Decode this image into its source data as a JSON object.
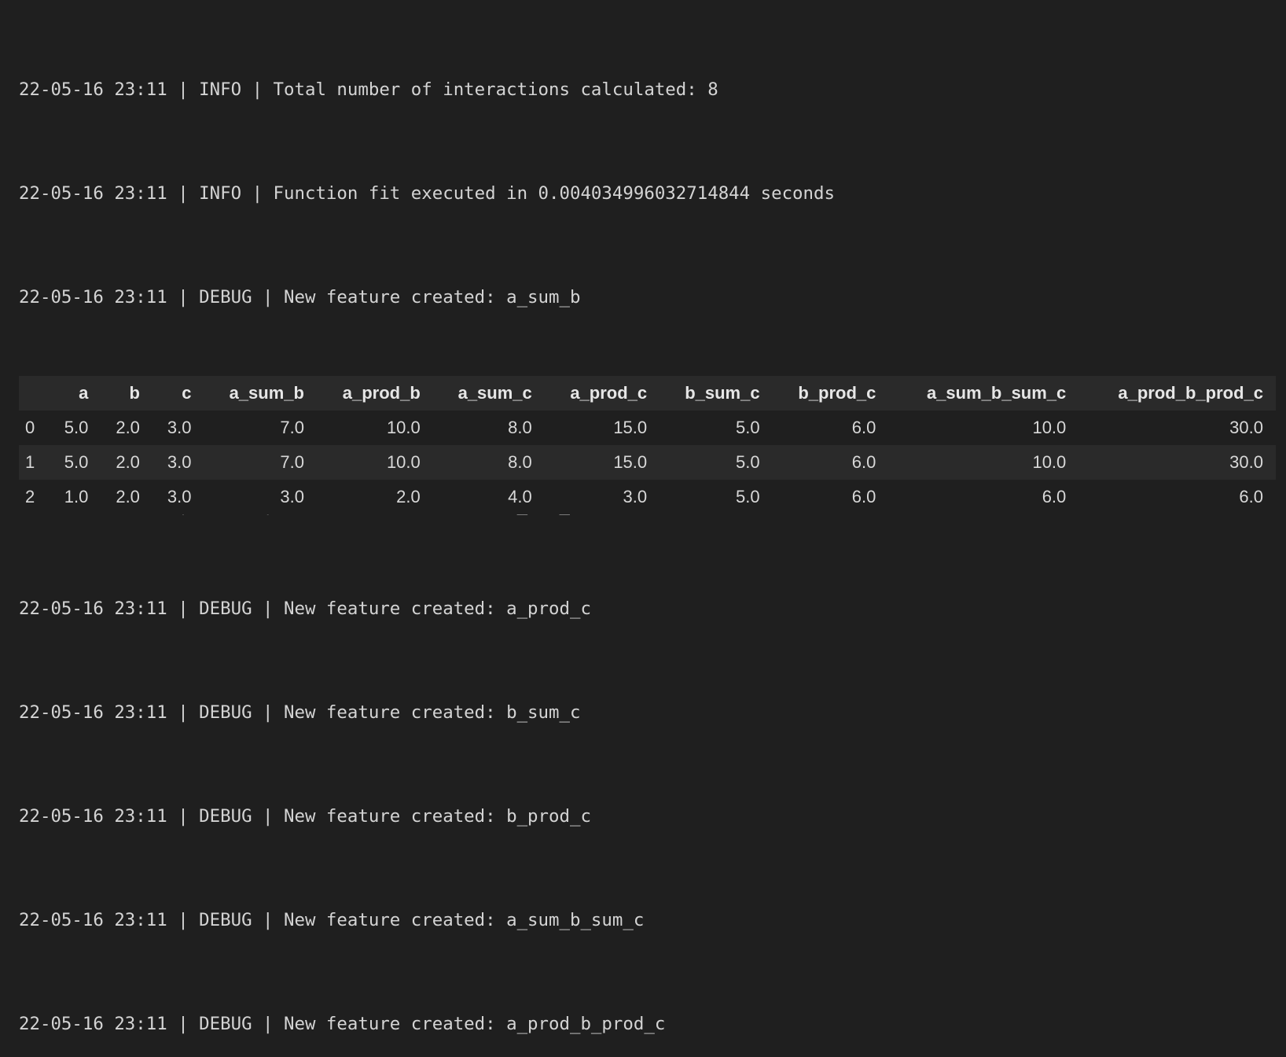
{
  "log_lines": [
    "22-05-16 23:11 | INFO | Total number of interactions calculated: 8",
    "22-05-16 23:11 | INFO | Function fit executed in 0.004034996032714844 seconds",
    "22-05-16 23:11 | DEBUG | New feature created: a_sum_b",
    "22-05-16 23:11 | DEBUG | New feature created: a_prod_b",
    "22-05-16 23:11 | DEBUG | New feature created: a_sum_c",
    "22-05-16 23:11 | DEBUG | New feature created: a_prod_c",
    "22-05-16 23:11 | DEBUG | New feature created: b_sum_c",
    "22-05-16 23:11 | DEBUG | New feature created: b_prod_c",
    "22-05-16 23:11 | DEBUG | New feature created: a_sum_b_sum_c",
    "22-05-16 23:11 | DEBUG | New feature created: a_prod_b_prod_c"
  ],
  "table": {
    "index_header": "",
    "columns": [
      "a",
      "b",
      "c",
      "a_sum_b",
      "a_prod_b",
      "a_sum_c",
      "a_prod_c",
      "b_sum_c",
      "b_prod_c",
      "a_sum_b_sum_c",
      "a_prod_b_prod_c"
    ],
    "rows": [
      {
        "index": "0",
        "values": [
          "5.0",
          "2.0",
          "3.0",
          "7.0",
          "10.0",
          "8.0",
          "15.0",
          "5.0",
          "6.0",
          "10.0",
          "30.0"
        ]
      },
      {
        "index": "1",
        "values": [
          "5.0",
          "2.0",
          "3.0",
          "7.0",
          "10.0",
          "8.0",
          "15.0",
          "5.0",
          "6.0",
          "10.0",
          "30.0"
        ]
      },
      {
        "index": "2",
        "values": [
          "1.0",
          "2.0",
          "3.0",
          "3.0",
          "2.0",
          "4.0",
          "3.0",
          "5.0",
          "6.0",
          "6.0",
          "6.0"
        ]
      }
    ]
  },
  "colors": {
    "background": "#1f1f1f",
    "stripe": "#2a2a2a",
    "text": "#d4d4d4"
  }
}
